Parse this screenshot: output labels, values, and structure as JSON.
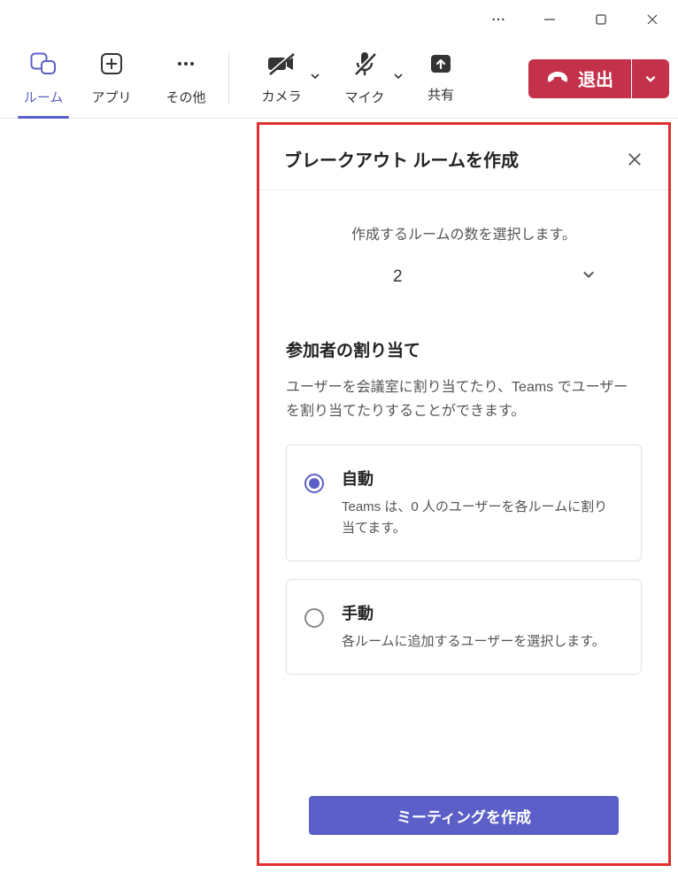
{
  "titlebar": {},
  "toolbar": {
    "rooms": "ルーム",
    "apps": "アプリ",
    "more": "その他",
    "camera": "カメラ",
    "mic": "マイク",
    "share": "共有",
    "leave": "退出"
  },
  "panel": {
    "title": "ブレークアウト ルームを作成",
    "rooms_select_label": "作成するルームの数を選択します。",
    "rooms_count": "2",
    "assign_title": "参加者の割り当て",
    "assign_desc": "ユーザーを会議室に割り当てたり、Teams でユーザーを割り当てたりすることができます。",
    "auto_title": "自動",
    "auto_desc": "Teams は、0 人のユーザーを各ルームに割り当てます。",
    "manual_title": "手動",
    "manual_desc": "各ルームに追加するユーザーを選択します。",
    "create_button": "ミーティングを作成"
  }
}
